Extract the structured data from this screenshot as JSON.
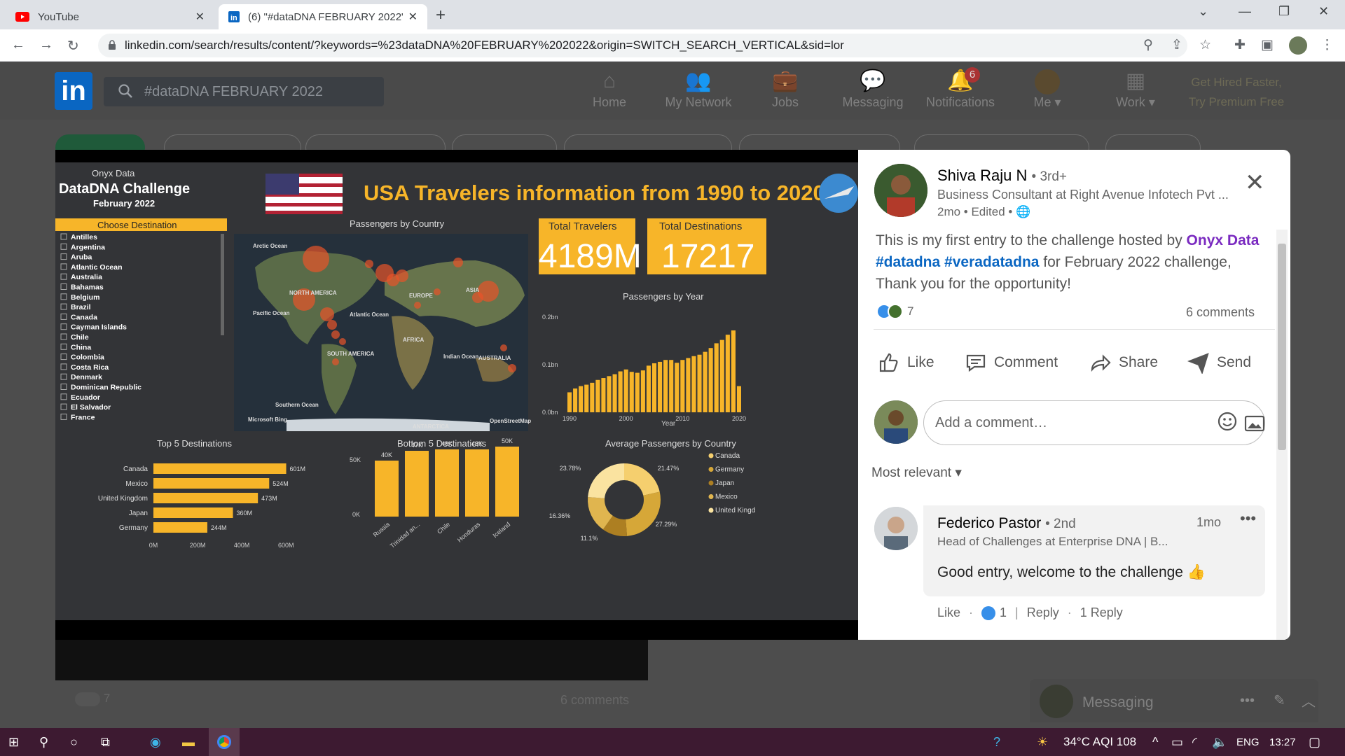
{
  "browser": {
    "tabs": [
      {
        "label": "YouTube"
      },
      {
        "label": "(6) \"#dataDNA FEBRUARY 2022\""
      }
    ],
    "url": "linkedin.com/search/results/content/?keywords=%23dataDNA%20FEBRUARY%202022&origin=SWITCH_SEARCH_VERTICAL&sid=lor"
  },
  "linkedin": {
    "search_value": "#dataDNA FEBRUARY 2022",
    "nav": [
      {
        "label": "Home",
        "icon": "home-icon"
      },
      {
        "label": "My Network",
        "icon": "network-icon"
      },
      {
        "label": "Jobs",
        "icon": "briefcase-icon"
      },
      {
        "label": "Messaging",
        "icon": "chat-icon"
      },
      {
        "label": "Notifications",
        "icon": "bell-icon",
        "badge": "6"
      },
      {
        "label": "Me",
        "icon": "avatar"
      },
      {
        "label": "Work",
        "icon": "grid-icon"
      }
    ],
    "premium": [
      "Get Hired Faster,",
      "Try Premium Free"
    ],
    "behind_post": {
      "reactions": "7",
      "comments": "6 comments"
    },
    "messaging": "Messaging"
  },
  "post": {
    "author": "Shiva Raju N",
    "degree": "• 3rd+",
    "headline": "Business Consultant at Right Avenue Infotech Pvt ...",
    "time": "2mo • Edited •",
    "text_start": "This is my first entry to the challenge hosted by",
    "text_entity": "Onyx Data",
    "text_tag1": "#datadna",
    "text_tag2": "#veradatadna",
    "text_end": "for February 2022 challenge, Thank you for the opportunity!",
    "reactions": "7",
    "comments": "6 comments",
    "actions": [
      {
        "label": "Like",
        "icon": "thumbs-up-icon"
      },
      {
        "label": "Comment",
        "icon": "comment-icon"
      },
      {
        "label": "Share",
        "icon": "share-icon"
      },
      {
        "label": "Send",
        "icon": "send-icon"
      }
    ],
    "comment_placeholder": "Add a comment…",
    "sort": "Most relevant",
    "comment": {
      "name": "Federico Pastor",
      "degree": "• 2nd",
      "headline": "Head of Challenges at Enterprise DNA | B...",
      "time": "1mo",
      "text": "Good entry, welcome to the challenge 👍",
      "like": "Like",
      "like_count": "1",
      "reply": "Reply",
      "replies": "1 Reply"
    }
  },
  "dashboard": {
    "brand": "Onyx Data",
    "challenge": "DataDNA Challenge",
    "month": "February 2022",
    "title": "USA Travelers information from 1990 to 2020",
    "choose": "Choose Destination",
    "destinations": [
      "Antilles",
      "Argentina",
      "Aruba",
      "Atlantic Ocean",
      "Australia",
      "Bahamas",
      "Belgium",
      "Brazil",
      "Canada",
      "Cayman Islands",
      "Chile",
      "China",
      "Colombia",
      "Costa Rica",
      "Denmark",
      "Dominican Republic",
      "Ecuador",
      "El Salvador",
      "France"
    ],
    "map_title": "Passengers by Country",
    "map_labels": [
      "Arctic Ocean",
      "NORTH AMERICA",
      "EUROPE",
      "ASIA",
      "Pacific Ocean",
      "Atlantic Ocean",
      "AFRICA",
      "SOUTH AMERICA",
      "Indian Ocean",
      "AUSTRALIA",
      "Southern Ocean",
      "ANTARCTICA",
      "Microsoft Bing",
      "OpenStreetMap"
    ],
    "kpi1_label": "Total Travelers",
    "kpi1_value": "4189M",
    "kpi2_label": "Total Destinations",
    "kpi2_value": "17217",
    "accent": "#f7b529"
  },
  "chart_data": [
    {
      "type": "bar",
      "title": "Passengers by Year",
      "xlabel": "Year",
      "ylabel": "",
      "x": [
        1990,
        1991,
        1992,
        1993,
        1994,
        1995,
        1996,
        1997,
        1998,
        1999,
        2000,
        2001,
        2002,
        2003,
        2004,
        2005,
        2006,
        2007,
        2008,
        2009,
        2010,
        2011,
        2012,
        2013,
        2014,
        2015,
        2016,
        2017,
        2018,
        2019,
        2020
      ],
      "values": [
        0.042,
        0.05,
        0.055,
        0.058,
        0.062,
        0.068,
        0.072,
        0.076,
        0.08,
        0.086,
        0.09,
        0.085,
        0.083,
        0.088,
        0.098,
        0.103,
        0.106,
        0.11,
        0.11,
        0.104,
        0.11,
        0.114,
        0.118,
        0.121,
        0.127,
        0.135,
        0.145,
        0.152,
        0.163,
        0.172,
        0.055
      ],
      "yticks": [
        "0.0bn",
        "0.1bn",
        "0.2bn"
      ],
      "xticks": [
        "1990",
        "2000",
        "2010",
        "2020"
      ],
      "ylim": [
        0,
        0.25
      ]
    },
    {
      "type": "bar",
      "title": "Top 5 Destinations",
      "categories": [
        "Canada",
        "Mexico",
        "United Kingdom",
        "Japan",
        "Germany"
      ],
      "values": [
        601,
        524,
        473,
        360,
        244
      ],
      "labels": [
        "601M",
        "524M",
        "473M",
        "360M",
        "244M"
      ],
      "xticks": [
        "0M",
        "200M",
        "400M",
        "600M"
      ],
      "xlim": [
        0,
        650
      ]
    },
    {
      "type": "bar",
      "title": "Bottom 5 Destinations",
      "categories": [
        "Russia",
        "Trinidad an...",
        "Chile",
        "Honduras",
        "Iceland"
      ],
      "values": [
        40,
        47,
        48,
        48,
        50
      ],
      "labels": [
        "40K",
        "47K",
        "48K",
        "48K",
        "50K"
      ],
      "yticks": [
        "0K",
        "50K"
      ],
      "ylim": [
        0,
        55
      ]
    },
    {
      "type": "pie",
      "title": "Average Passengers by Country",
      "categories": [
        "Canada",
        "Germany",
        "Japan",
        "Mexico",
        "United Kingdom"
      ],
      "values": [
        21.47,
        27.29,
        11.1,
        16.36,
        23.78
      ],
      "labels": [
        "21.47%",
        "27.29%",
        "11.1%",
        "16.36%",
        "23.78%"
      ],
      "legend_labels": [
        "Canada",
        "Germany",
        "Japan",
        "Mexico",
        "United Kingd"
      ],
      "colors": [
        "#f5cf6e",
        "#d6a738",
        "#ad7f22",
        "#e0b54f",
        "#fae3a0"
      ]
    }
  ],
  "taskbar": {
    "weather": "34°C AQI 108",
    "lang": "ENG",
    "time": "13:27"
  }
}
